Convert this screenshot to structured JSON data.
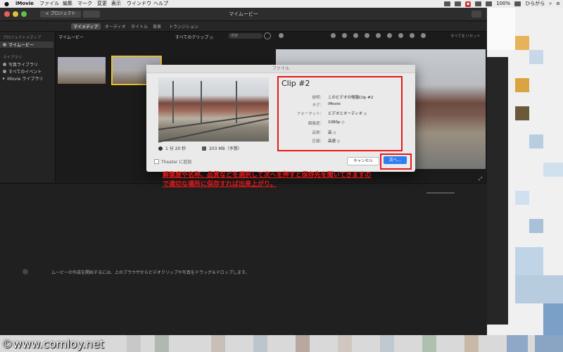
{
  "menubar": {
    "app": "iMovie",
    "items": [
      "ファイル",
      "編集",
      "マーク",
      "変更",
      "表示",
      "ウインドウ",
      "ヘルプ"
    ],
    "battery": "100%",
    "user": "ひらがら"
  },
  "window": {
    "title": "マイムービー",
    "project_button": "< プロジェクト"
  },
  "tabs": {
    "media": "マイメディア",
    "audio": "オーディオ",
    "titles": "タイトル",
    "backgrounds": "背景",
    "transitions": "トランジション"
  },
  "sidebar": {
    "project_media_header": "プロジェクトメディア",
    "project_item": "マイムービー",
    "library_header": "ライブラリ",
    "items": [
      "写真ライブラリ",
      "すべてのイベント",
      "iMovie ライブラリ"
    ]
  },
  "browser": {
    "header": "マイムービー",
    "all_clips": "すべてのクリップ ◇",
    "search_placeholder": "検索"
  },
  "viewer": {
    "reset_all": "すべてをリセット"
  },
  "timeline": {
    "message": "ムービーの作成を開始するには、上のブラウザからビデオクリップや写真をドラッグ＆ドロップします。"
  },
  "dialog": {
    "title": "ファイル",
    "clip_title": "Clip #2",
    "duration": "1 分 20 秒",
    "size": "203 MB（予想）",
    "theater_label": "Theater に追加",
    "properties": [
      {
        "key": "説明：",
        "value": "このビデオの情報Clip #2"
      },
      {
        "key": "タグ：",
        "value": "iMovie"
      },
      {
        "key": "フォーマット：",
        "value": "ビデオとオーディオ ◇"
      },
      {
        "key": "解像度：",
        "value": "1080p ◇"
      },
      {
        "key": "品質：",
        "value": "高 ◇"
      },
      {
        "key": "圧縮：",
        "value": "高速 ◇"
      }
    ],
    "cancel": "キャンセル",
    "next": "次へ..."
  },
  "caption": {
    "line1": "解像度や名称、品質などを選択して次へを押すと保存先を聞いてきますの",
    "line2": "で適切な場所に保存すれば出来上がり。"
  },
  "watermark": "©www.comloy.net",
  "colors": {
    "annotation_red": "#e81818",
    "next_button_blue": "#2f7ef0"
  }
}
